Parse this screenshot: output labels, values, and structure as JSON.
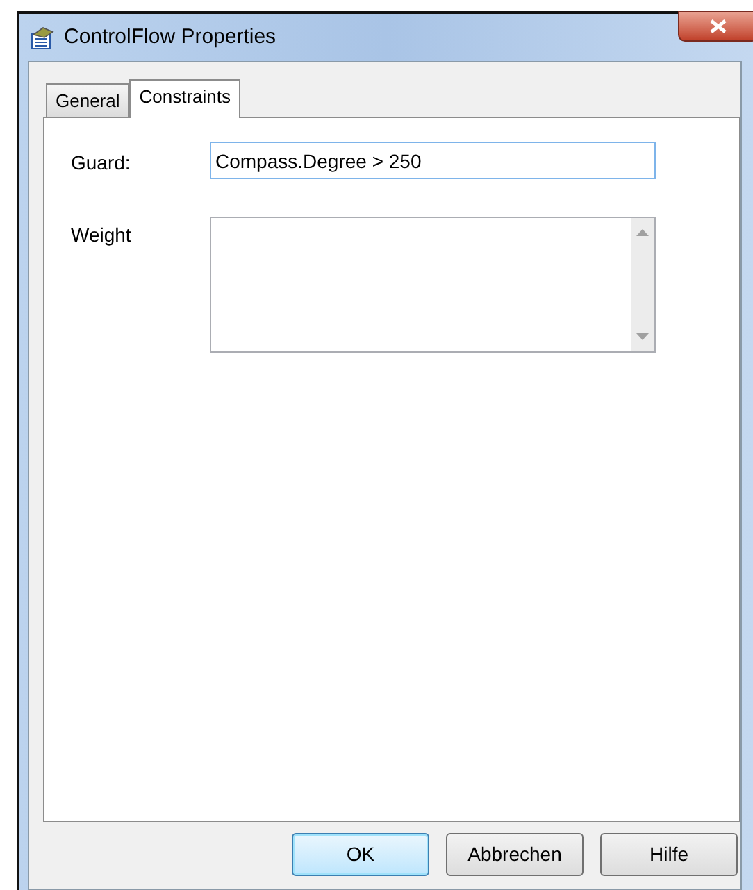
{
  "window": {
    "title": "ControlFlow Properties"
  },
  "tabs": [
    {
      "label": "General",
      "selected": false
    },
    {
      "label": "Constraints",
      "selected": true
    }
  ],
  "fields": [
    {
      "kind": "text",
      "label": "Guard:",
      "value": "Compass.Degree > 250"
    },
    {
      "kind": "multiline",
      "label": "Weight"
    }
  ],
  "buttons": [
    {
      "label": "OK",
      "default": true
    },
    {
      "label": "Abbrechen",
      "default": false
    },
    {
      "label": "Hilfe",
      "default": false
    }
  ]
}
